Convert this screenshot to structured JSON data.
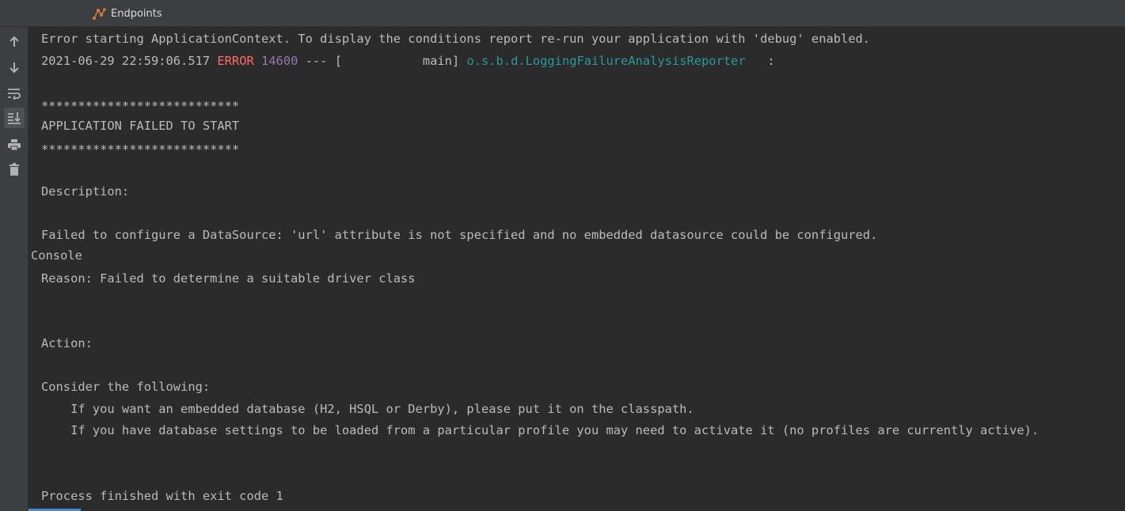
{
  "tabs": {
    "console_label": "Console",
    "endpoints_label": "Endpoints"
  },
  "toolbar": {
    "icons": [
      "up-arrow-icon",
      "down-arrow-icon",
      "soft-wrap-icon",
      "scroll-to-end-icon",
      "print-icon",
      "trash-icon"
    ]
  },
  "colors": {
    "background": "#2b2b2b",
    "panel": "#3c3f41",
    "text": "#bbbbbb",
    "error": "#ff6b68",
    "pid": "#9876aa",
    "logger": "#299999",
    "tab_underline": "#4a88c7"
  },
  "console": {
    "line1": "Error starting ApplicationContext. To display the conditions report re-run your application with 'debug' enabled.",
    "line2_timestamp": "2021-06-29 22:59:06.517 ",
    "line2_level": "ERROR",
    "line2_space": " ",
    "line2_pid": "14600",
    "line2_thread": " --- [           main] ",
    "line2_logger": "o.s.b.d.LoggingFailureAnalysisReporter",
    "line2_tail": "   :",
    "stars1": "***************************",
    "failed_title": "APPLICATION FAILED TO START",
    "stars2": "***************************",
    "description_label": "Description:",
    "description_text": "Failed to configure a DataSource: 'url' attribute is not specified and no embedded datasource could be configured.",
    "reason_text": "Reason: Failed to determine a suitable driver class",
    "action_label": "Action:",
    "consider_text": "Consider the following:",
    "suggestion1": "    If you want an embedded database (H2, HSQL or Derby), please put it on the classpath.",
    "suggestion2": "    If you have database settings to be loaded from a particular profile you may need to activate it (no profiles are currently active).",
    "exit_text": "Process finished with exit code 1"
  }
}
